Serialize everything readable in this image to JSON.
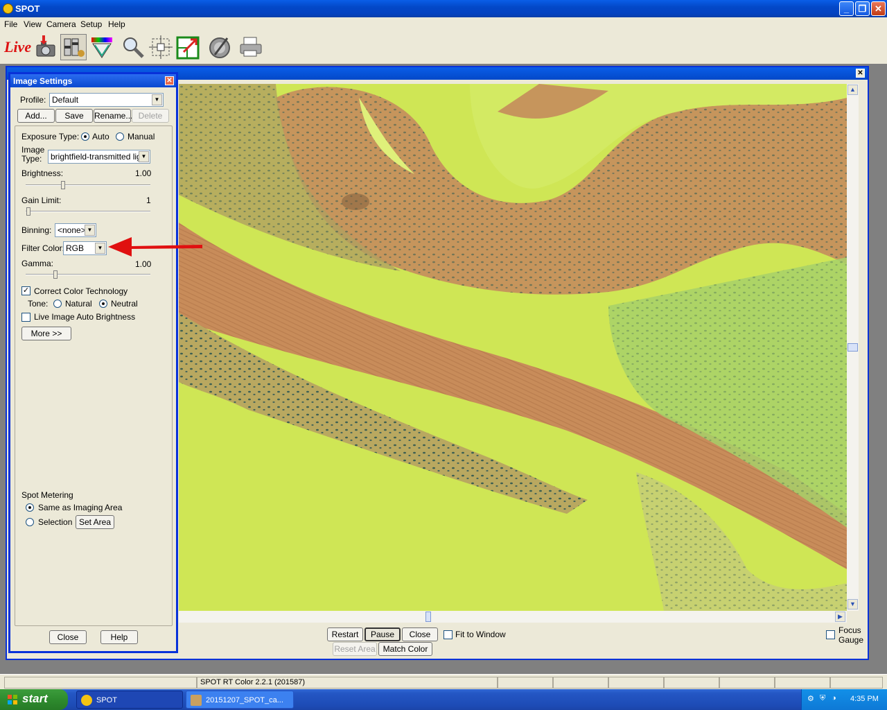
{
  "app": {
    "title": "SPOT"
  },
  "menu": [
    "File",
    "View",
    "Camera",
    "Setup",
    "Help"
  ],
  "toolbar": {
    "live_label": "Live"
  },
  "settings": {
    "title": "Image Settings",
    "profile_label": "Profile:",
    "profile_value": "Default",
    "buttons": {
      "add": "Add...",
      "save": "Save",
      "rename": "Rename...",
      "delete": "Delete"
    },
    "exposure_label": "Exposure Type:",
    "exposure_auto": "Auto",
    "exposure_manual": "Manual",
    "image_type_label_1": "Image",
    "image_type_label_2": "Type:",
    "image_type_value": "brightfield-transmitted light",
    "brightness_label": "Brightness:",
    "brightness_value": "1.00",
    "gain_label": "Gain Limit:",
    "gain_value": "1",
    "binning_label": "Binning:",
    "binning_value": "<none>",
    "filter_label": "Filter Color:",
    "filter_value": "RGB",
    "gamma_label": "Gamma:",
    "gamma_value": "1.00",
    "cct_label": "Correct Color Technology",
    "tone_label": "Tone:",
    "tone_natural": "Natural",
    "tone_neutral": "Neutral",
    "live_auto_label": "Live Image Auto Brightness",
    "more_label": "More >>",
    "spot_metering_label": "Spot Metering",
    "same_as_label": "Same as Imaging Area",
    "selection_label": "Selection",
    "set_area_label": "Set Area",
    "close_label": "Close",
    "help_label": "Help"
  },
  "live": {
    "restart": "Restart",
    "pause": "Pause",
    "close": "Close",
    "fit_to_window": "Fit to Window",
    "reset_area": "Reset Area",
    "match_color": "Match Color",
    "focus_1": "Focus",
    "focus_2": "Gauge"
  },
  "status": {
    "version": "SPOT RT Color 2.2.1  (201587)"
  },
  "taskbar": {
    "start": "start",
    "tasks": [
      "SPOT",
      "20151207_SPOT_ca..."
    ],
    "clock": "4:35 PM"
  },
  "colors": {
    "accent": "#0831d9",
    "image_bg": "#cfe655",
    "tissue": "#c98a55",
    "arrow": "#e01010"
  }
}
